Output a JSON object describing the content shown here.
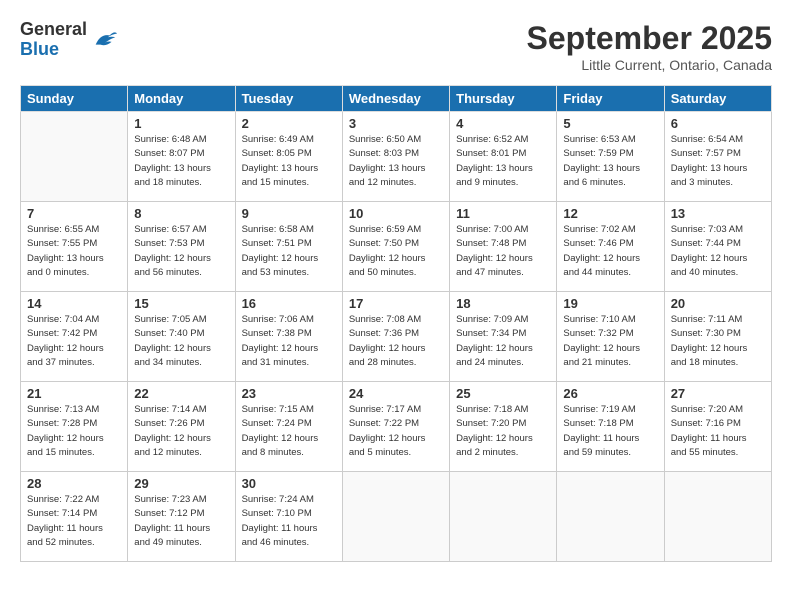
{
  "header": {
    "logo": {
      "general": "General",
      "blue": "Blue"
    },
    "title": "September 2025",
    "subtitle": "Little Current, Ontario, Canada"
  },
  "days_of_week": [
    "Sunday",
    "Monday",
    "Tuesday",
    "Wednesday",
    "Thursday",
    "Friday",
    "Saturday"
  ],
  "weeks": [
    [
      {
        "day": "",
        "info": ""
      },
      {
        "day": "1",
        "info": "Sunrise: 6:48 AM\nSunset: 8:07 PM\nDaylight: 13 hours\nand 18 minutes."
      },
      {
        "day": "2",
        "info": "Sunrise: 6:49 AM\nSunset: 8:05 PM\nDaylight: 13 hours\nand 15 minutes."
      },
      {
        "day": "3",
        "info": "Sunrise: 6:50 AM\nSunset: 8:03 PM\nDaylight: 13 hours\nand 12 minutes."
      },
      {
        "day": "4",
        "info": "Sunrise: 6:52 AM\nSunset: 8:01 PM\nDaylight: 13 hours\nand 9 minutes."
      },
      {
        "day": "5",
        "info": "Sunrise: 6:53 AM\nSunset: 7:59 PM\nDaylight: 13 hours\nand 6 minutes."
      },
      {
        "day": "6",
        "info": "Sunrise: 6:54 AM\nSunset: 7:57 PM\nDaylight: 13 hours\nand 3 minutes."
      }
    ],
    [
      {
        "day": "7",
        "info": "Sunrise: 6:55 AM\nSunset: 7:55 PM\nDaylight: 13 hours\nand 0 minutes."
      },
      {
        "day": "8",
        "info": "Sunrise: 6:57 AM\nSunset: 7:53 PM\nDaylight: 12 hours\nand 56 minutes."
      },
      {
        "day": "9",
        "info": "Sunrise: 6:58 AM\nSunset: 7:51 PM\nDaylight: 12 hours\nand 53 minutes."
      },
      {
        "day": "10",
        "info": "Sunrise: 6:59 AM\nSunset: 7:50 PM\nDaylight: 12 hours\nand 50 minutes."
      },
      {
        "day": "11",
        "info": "Sunrise: 7:00 AM\nSunset: 7:48 PM\nDaylight: 12 hours\nand 47 minutes."
      },
      {
        "day": "12",
        "info": "Sunrise: 7:02 AM\nSunset: 7:46 PM\nDaylight: 12 hours\nand 44 minutes."
      },
      {
        "day": "13",
        "info": "Sunrise: 7:03 AM\nSunset: 7:44 PM\nDaylight: 12 hours\nand 40 minutes."
      }
    ],
    [
      {
        "day": "14",
        "info": "Sunrise: 7:04 AM\nSunset: 7:42 PM\nDaylight: 12 hours\nand 37 minutes."
      },
      {
        "day": "15",
        "info": "Sunrise: 7:05 AM\nSunset: 7:40 PM\nDaylight: 12 hours\nand 34 minutes."
      },
      {
        "day": "16",
        "info": "Sunrise: 7:06 AM\nSunset: 7:38 PM\nDaylight: 12 hours\nand 31 minutes."
      },
      {
        "day": "17",
        "info": "Sunrise: 7:08 AM\nSunset: 7:36 PM\nDaylight: 12 hours\nand 28 minutes."
      },
      {
        "day": "18",
        "info": "Sunrise: 7:09 AM\nSunset: 7:34 PM\nDaylight: 12 hours\nand 24 minutes."
      },
      {
        "day": "19",
        "info": "Sunrise: 7:10 AM\nSunset: 7:32 PM\nDaylight: 12 hours\nand 21 minutes."
      },
      {
        "day": "20",
        "info": "Sunrise: 7:11 AM\nSunset: 7:30 PM\nDaylight: 12 hours\nand 18 minutes."
      }
    ],
    [
      {
        "day": "21",
        "info": "Sunrise: 7:13 AM\nSunset: 7:28 PM\nDaylight: 12 hours\nand 15 minutes."
      },
      {
        "day": "22",
        "info": "Sunrise: 7:14 AM\nSunset: 7:26 PM\nDaylight: 12 hours\nand 12 minutes."
      },
      {
        "day": "23",
        "info": "Sunrise: 7:15 AM\nSunset: 7:24 PM\nDaylight: 12 hours\nand 8 minutes."
      },
      {
        "day": "24",
        "info": "Sunrise: 7:17 AM\nSunset: 7:22 PM\nDaylight: 12 hours\nand 5 minutes."
      },
      {
        "day": "25",
        "info": "Sunrise: 7:18 AM\nSunset: 7:20 PM\nDaylight: 12 hours\nand 2 minutes."
      },
      {
        "day": "26",
        "info": "Sunrise: 7:19 AM\nSunset: 7:18 PM\nDaylight: 11 hours\nand 59 minutes."
      },
      {
        "day": "27",
        "info": "Sunrise: 7:20 AM\nSunset: 7:16 PM\nDaylight: 11 hours\nand 55 minutes."
      }
    ],
    [
      {
        "day": "28",
        "info": "Sunrise: 7:22 AM\nSunset: 7:14 PM\nDaylight: 11 hours\nand 52 minutes."
      },
      {
        "day": "29",
        "info": "Sunrise: 7:23 AM\nSunset: 7:12 PM\nDaylight: 11 hours\nand 49 minutes."
      },
      {
        "day": "30",
        "info": "Sunrise: 7:24 AM\nSunset: 7:10 PM\nDaylight: 11 hours\nand 46 minutes."
      },
      {
        "day": "",
        "info": ""
      },
      {
        "day": "",
        "info": ""
      },
      {
        "day": "",
        "info": ""
      },
      {
        "day": "",
        "info": ""
      }
    ]
  ]
}
